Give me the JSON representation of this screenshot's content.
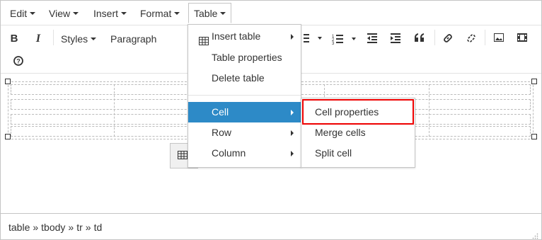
{
  "menubar": {
    "items": [
      {
        "label": "Edit"
      },
      {
        "label": "View"
      },
      {
        "label": "Insert"
      },
      {
        "label": "Format"
      },
      {
        "label": "Table"
      }
    ]
  },
  "toolbar": {
    "bold_label": "B",
    "italic_label": "I",
    "styles_label": "Styles",
    "paragraph_label": "Paragraph"
  },
  "table_menu": {
    "items": [
      {
        "label": "Insert table"
      },
      {
        "label": "Table properties"
      },
      {
        "label": "Delete table"
      },
      {
        "label": "Cell"
      },
      {
        "label": "Row"
      },
      {
        "label": "Column"
      }
    ]
  },
  "cell_submenu": {
    "items": [
      {
        "label": "Cell properties"
      },
      {
        "label": "Merge cells"
      },
      {
        "label": "Split cell"
      }
    ]
  },
  "statusbar": {
    "path": [
      "table",
      "tbody",
      "tr",
      "td"
    ],
    "separator": "»"
  },
  "colors": {
    "selected_bg": "#2d8ac7",
    "highlight": "#e00000",
    "border": "#c5c5c5"
  }
}
